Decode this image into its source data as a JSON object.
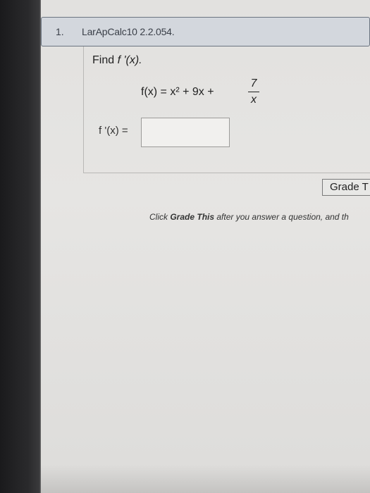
{
  "question": {
    "number": "1.",
    "title": "LarApCalc10 2.2.054.",
    "prompt_prefix": "Find ",
    "prompt_func": "f '(x).",
    "equation_lhs": "f(x) = x² + 9x +",
    "fraction_numerator": "7",
    "fraction_denominator": "x"
  },
  "answer": {
    "label": "f '(x) =",
    "value": ""
  },
  "grade_button": {
    "label": "Grade T"
  },
  "instruction": {
    "prefix": "Click ",
    "emphasis": "Grade This",
    "suffix": " after you answer a question, and th"
  }
}
